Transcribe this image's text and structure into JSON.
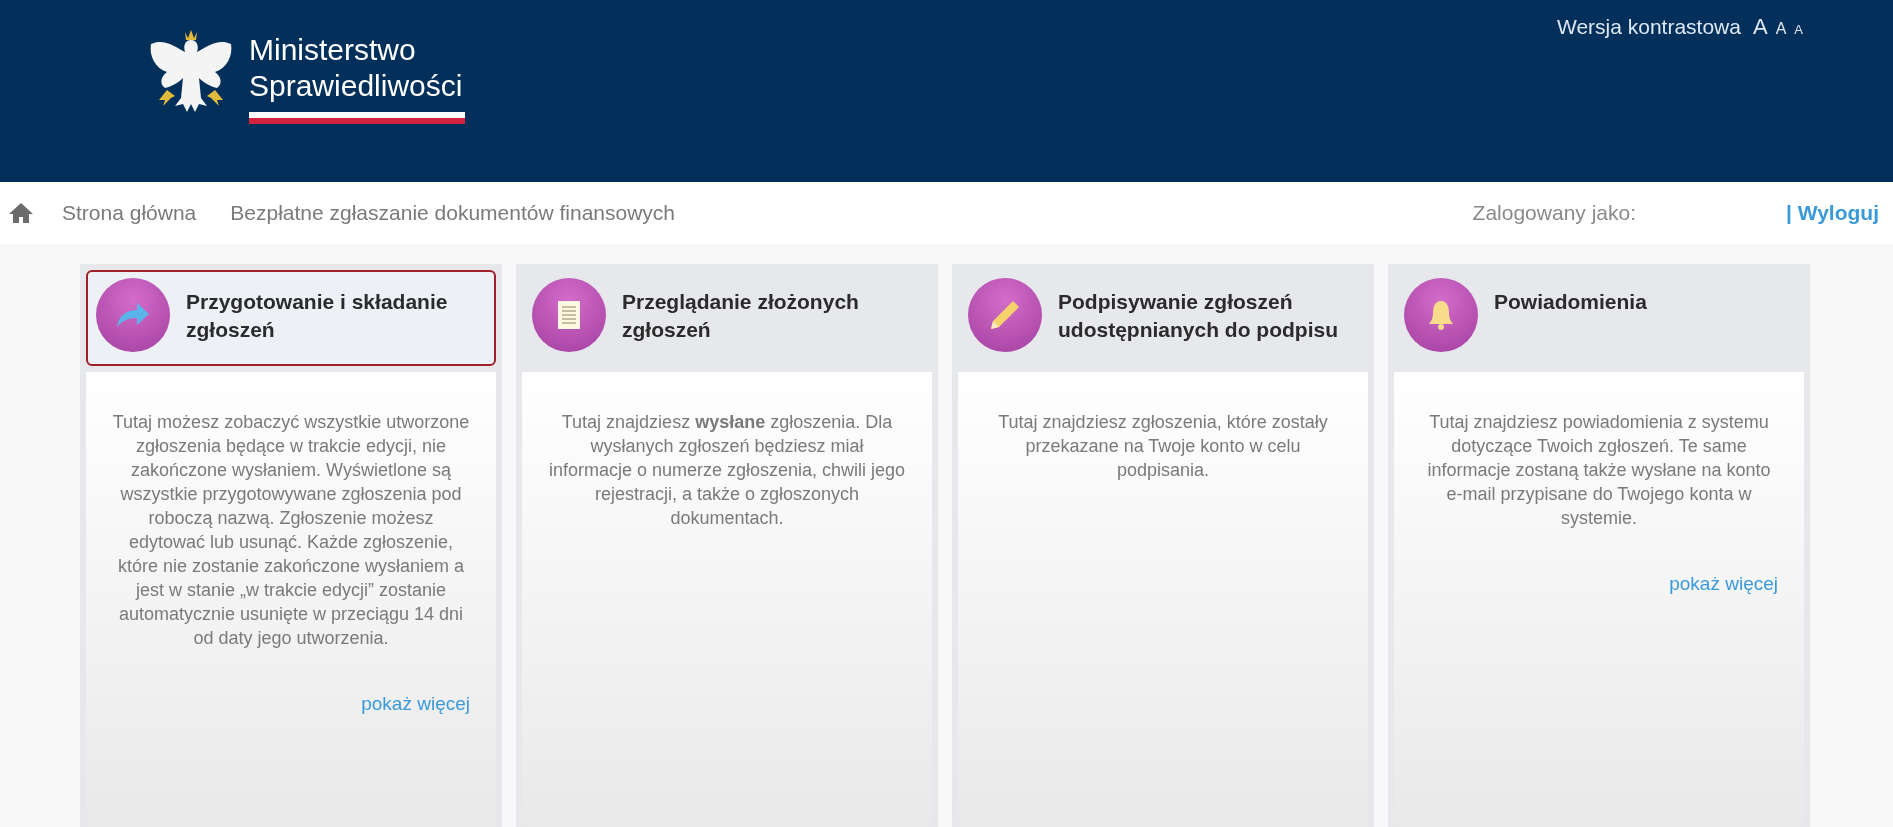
{
  "header": {
    "logo_lines": [
      "Ministerstwo",
      "Sprawiedliwości"
    ],
    "contrast_label": "Wersja kontrastowa",
    "font_sizes": [
      "A",
      "A",
      "A"
    ]
  },
  "nav": {
    "breadcrumbs": [
      "Strona główna",
      "Bezpłatne zgłaszanie dokumentów finansowych"
    ],
    "logged_in_label": "Zalogowany jako:",
    "logout": "| Wyloguj"
  },
  "cards": [
    {
      "title": "Przygotowanie i składanie zgłoszeń",
      "selected": true,
      "text": "Tutaj możesz zobaczyć wszystkie utworzone zgłoszenia  będące w trakcie edycji, nie zakończone wysłaniem. Wyświetlone są wszystkie przygotowywane zgłoszenia pod roboczą nazwą. Zgłoszenie możesz edytować lub usunąć. Każde zgłoszenie,  które nie zostanie zakończone wysłaniem a jest  w stanie „w trakcie edycji” zostanie automatycznie usunięte w przeciągu 14 dni od daty jego utworzenia.",
      "link": "pokaż więcej"
    },
    {
      "title": "Przeglądanie złożonych zgłoszeń",
      "selected": false,
      "text": "Tutaj znajdziesz **wysłane** zgłoszenia. Dla wysłanych zgłoszeń będziesz miał informacje o numerze zgłoszenia, chwili jego rejestracji, a także o zgłoszonych dokumentach."
    },
    {
      "title": "Podpisywanie zgłoszeń udostępnianych do podpisu",
      "selected": false,
      "text": "Tutaj znajdziesz zgłoszenia, które zostały przekazane na Twoje konto w celu podpisania."
    },
    {
      "title": "Powiadomienia",
      "selected": false,
      "text": "Tutaj znajdziesz powiadomienia z systemu dotyczące Twoich zgłoszeń. Te same informacje zostaną także wysłane na konto e-mail przypisane do Twojego konta w systemie.",
      "link": "pokaż więcej"
    }
  ]
}
